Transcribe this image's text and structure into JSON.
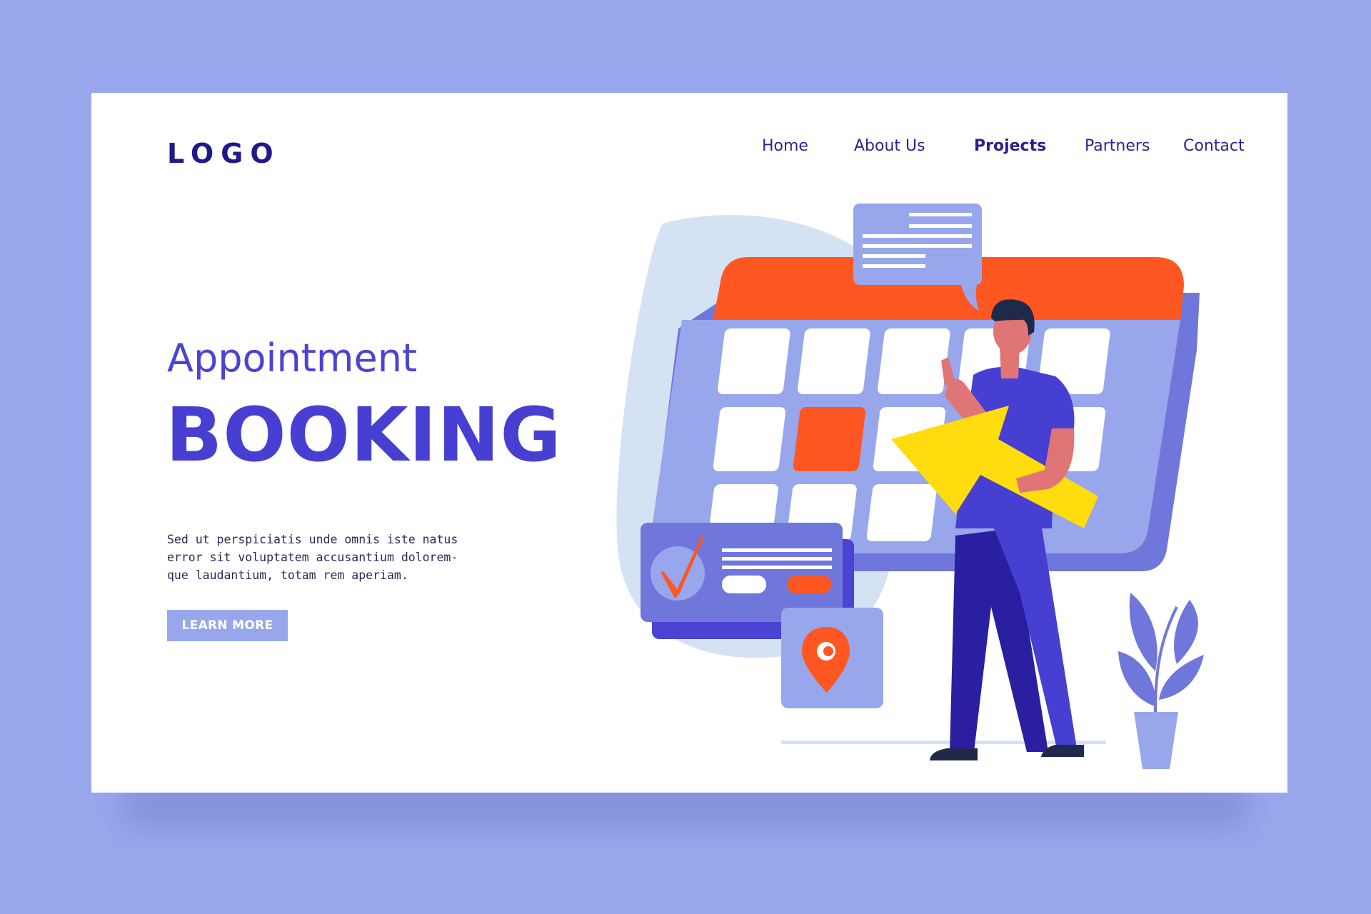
{
  "header": {
    "logo": "LOGO",
    "nav": [
      {
        "label": "Home",
        "active": false
      },
      {
        "label": "About Us",
        "active": false
      },
      {
        "label": "Projects",
        "active": true
      },
      {
        "label": "Partners",
        "active": false
      },
      {
        "label": "Contact",
        "active": false
      }
    ]
  },
  "hero": {
    "title_line_1": "Appointment",
    "title_line_2": "BOOKING",
    "body_lines": [
      "Sed ut perspiciatis unde omnis iste natus",
      "error sit voluptatem accusantium dolorem-",
      "que laudantium, totam rem aperiam."
    ],
    "cta_label": "LEARN MORE"
  },
  "colors": {
    "background": "#98a7ec",
    "accent_blue": "#463fd2",
    "navy": "#1f1a8a",
    "orange": "#ff5722",
    "yellow": "#ffdc0e",
    "lavender": "#98a7ec"
  },
  "illustration": {
    "icons": [
      "calendar-icon",
      "chat-bubble-icon",
      "checkmark-icon",
      "location-pin-icon",
      "arrow-icon",
      "plant-icon",
      "person-figure"
    ]
  }
}
